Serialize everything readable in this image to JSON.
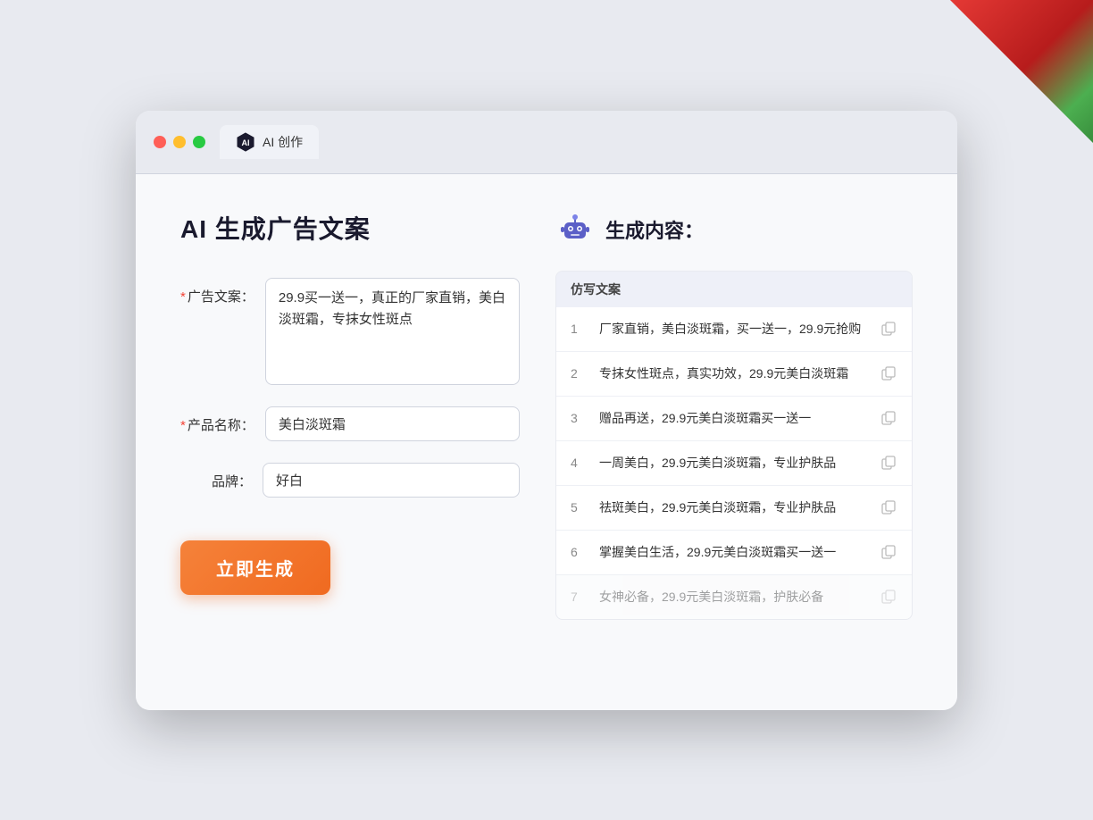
{
  "window": {
    "tab_label": "AI 创作",
    "traffic_lights": [
      "red",
      "yellow",
      "green"
    ]
  },
  "left_panel": {
    "title": "AI 生成广告文案",
    "form": {
      "ad_copy_label": "广告文案：",
      "ad_copy_required": "*",
      "ad_copy_value": "29.9买一送一，真正的厂家直销，美白淡斑霜，专抹女性斑点",
      "product_name_label": "产品名称：",
      "product_name_required": "*",
      "product_name_value": "美白淡斑霜",
      "brand_label": "品牌：",
      "brand_value": "好白"
    },
    "generate_button": "立即生成"
  },
  "right_panel": {
    "title": "生成内容：",
    "results_header": "仿写文案",
    "results": [
      {
        "num": "1",
        "text": "厂家直销，美白淡斑霜，买一送一，29.9元抢购",
        "faded": false
      },
      {
        "num": "2",
        "text": "专抹女性斑点，真实功效，29.9元美白淡斑霜",
        "faded": false
      },
      {
        "num": "3",
        "text": "赠品再送，29.9元美白淡斑霜买一送一",
        "faded": false
      },
      {
        "num": "4",
        "text": "一周美白，29.9元美白淡斑霜，专业护肤品",
        "faded": false
      },
      {
        "num": "5",
        "text": "祛斑美白，29.9元美白淡斑霜，专业护肤品",
        "faded": false
      },
      {
        "num": "6",
        "text": "掌握美白生活，29.9元美白淡斑霜买一送一",
        "faded": false
      },
      {
        "num": "7",
        "text": "女神必备，29.9元美白淡斑霜，护肤必备",
        "faded": true
      }
    ]
  }
}
